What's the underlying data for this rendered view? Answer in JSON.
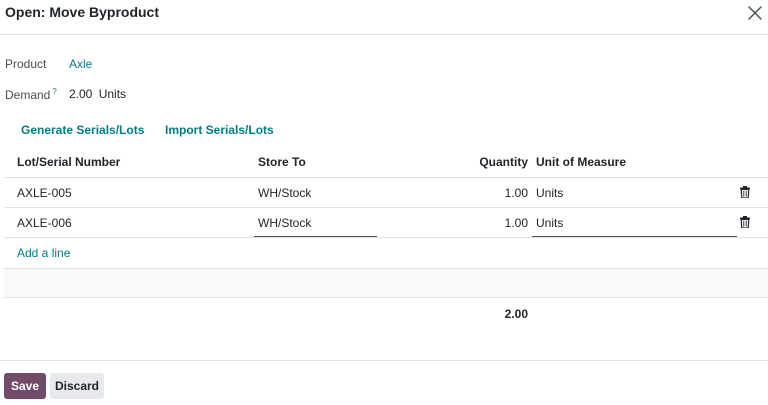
{
  "dialog": {
    "title": "Open: Move Byproduct"
  },
  "form": {
    "product_label": "Product",
    "product_value": "Axle",
    "demand_label": "Demand",
    "demand_help": "?",
    "demand_value": "2.00",
    "demand_unit": "Units"
  },
  "actions": {
    "generate": "Generate Serials/Lots",
    "import": "Import Serials/Lots"
  },
  "table": {
    "columns": [
      "Lot/Serial Number",
      "Store To",
      "Quantity",
      "Unit of Measure"
    ],
    "rows": [
      {
        "lot": "AXLE-005",
        "store_to": "WH/Stock",
        "quantity": "1.00",
        "uom": "Units"
      },
      {
        "lot": "AXLE-006",
        "store_to": "WH/Stock",
        "quantity": "1.00",
        "uom": "Units"
      }
    ],
    "add_line": "Add a line",
    "total_quantity": "2.00"
  },
  "footer": {
    "save": "Save",
    "discard": "Discard"
  },
  "colors": {
    "link": "#017e84",
    "primary": "#714b67",
    "secondary": "#e7e9ed"
  },
  "icons": [
    "close-icon",
    "trash-icon"
  ]
}
